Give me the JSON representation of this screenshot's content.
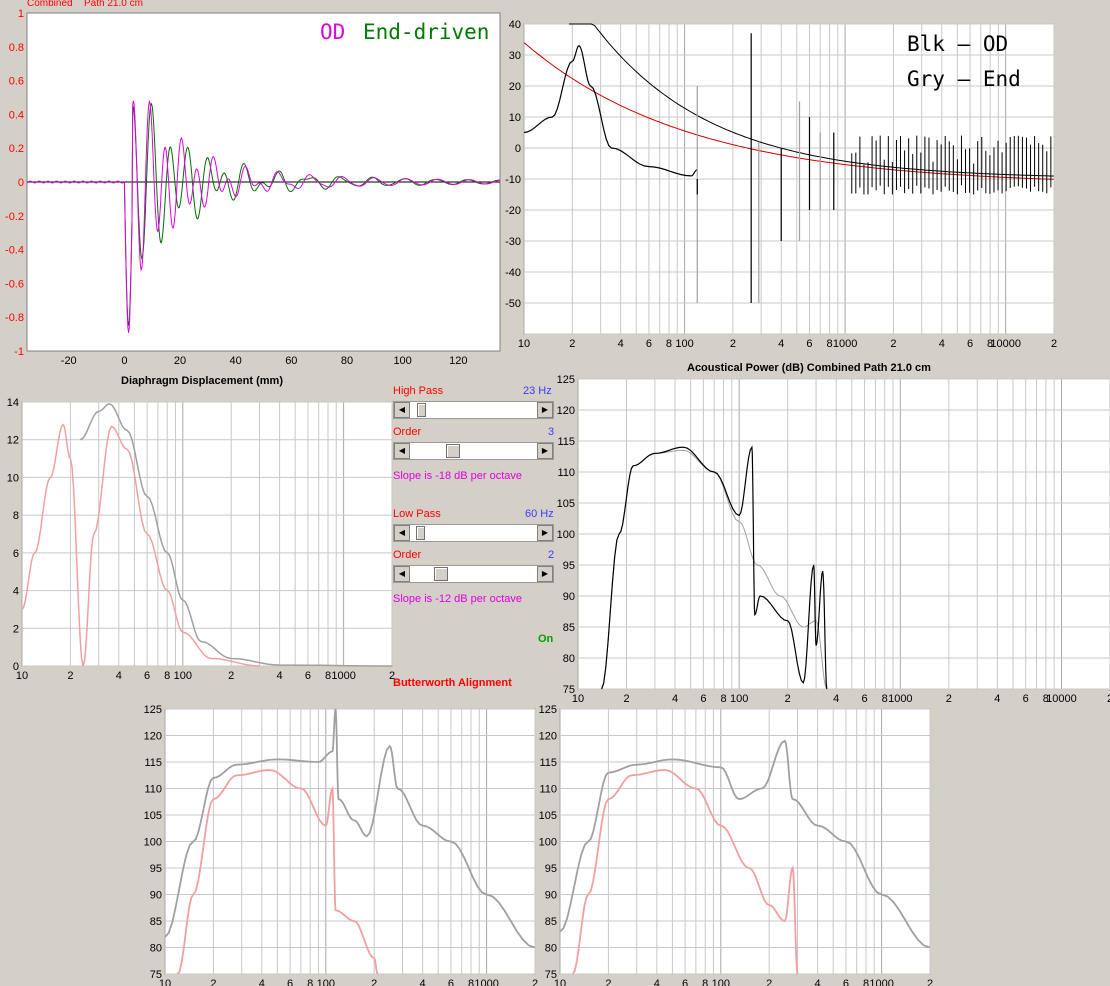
{
  "top_left": {
    "caption_type": "Combined",
    "caption_path": "Path 21.0 cm",
    "annotation_od": "OD",
    "annotation_end": "End-driven",
    "xlabel": "Diaphragm Displacement (mm)",
    "yticks": [
      "1",
      "0.8",
      "0.6",
      "0.4",
      "0.2",
      "0",
      "-0.2",
      "-0.4",
      "-0.6",
      "-0.8",
      "-1"
    ],
    "xticks": [
      "-20",
      "0",
      "20",
      "40",
      "60",
      "80",
      "100",
      "120"
    ]
  },
  "top_right": {
    "annotation_line1": "Blk — OD",
    "annotation_line2": "Gry — End",
    "yticks": [
      "40",
      "30",
      "20",
      "10",
      "0",
      "-10",
      "-20",
      "-30",
      "-40",
      "-50"
    ],
    "xticks": [
      "10",
      "2",
      "4",
      "6",
      "8",
      "100",
      "2",
      "4",
      "6",
      "8",
      "1000",
      "2",
      "4",
      "6",
      "8",
      "10000",
      "2"
    ]
  },
  "mid_left": {
    "yticks": [
      "14",
      "12",
      "10",
      "8",
      "6",
      "4",
      "2",
      "0"
    ],
    "xticks": [
      "10",
      "2",
      "4",
      "6",
      "8",
      "100",
      "2",
      "4",
      "6",
      "8",
      "1000",
      "2"
    ]
  },
  "controls": {
    "high_pass_label": "High Pass",
    "high_pass_value": "23 Hz",
    "hp_order_label": "Order",
    "hp_order_value": "3",
    "hp_slope_text": "Slope is -18 dB per octave",
    "low_pass_label": "Low Pass",
    "low_pass_value": "60 Hz",
    "lp_order_label": "Order",
    "lp_order_value": "2",
    "lp_slope_text": "Slope is -12 dB per octave",
    "on_label": "On",
    "alignment_label": "Butterworth Alignment",
    "slider_levels": {
      "high_pass": 0.06,
      "hp_order": 0.3,
      "low_pass": 0.05,
      "lp_order": 0.2
    }
  },
  "mid_right": {
    "title": "Acoustical Power (dB)   Combined   Path 21.0 cm",
    "yticks": [
      "125",
      "120",
      "115",
      "110",
      "105",
      "100",
      "95",
      "90",
      "85",
      "80",
      "75"
    ],
    "xticks": [
      "10",
      "2",
      "4",
      "6",
      "8",
      "100",
      "2",
      "4",
      "6",
      "8",
      "1000",
      "2",
      "4",
      "6",
      "8",
      "10000",
      "2"
    ]
  },
  "bottom_left": {
    "yticks": [
      "125",
      "120",
      "115",
      "110",
      "105",
      "100",
      "95",
      "90",
      "85",
      "80",
      "75"
    ],
    "xticks": [
      "10",
      "2",
      "4",
      "6",
      "8",
      "100",
      "2",
      "4",
      "6",
      "8",
      "1000",
      "2"
    ]
  },
  "bottom_right": {
    "yticks": [
      "125",
      "120",
      "115",
      "110",
      "105",
      "100",
      "95",
      "90",
      "85",
      "80",
      "75"
    ],
    "xticks": [
      "10",
      "2",
      "4",
      "6",
      "8",
      "100",
      "2",
      "4",
      "6",
      "8",
      "1000",
      "2"
    ]
  },
  "colors": {
    "plot_bg": "#ffffff",
    "grid": "#c8c8c8",
    "od_trace": "#e000e0",
    "end_trace": "#007000",
    "black_trace": "#000000",
    "gray_trace": "#a0a0a0",
    "pink_trace": "#f0a0a0",
    "red_trace": "#d00000"
  }
}
